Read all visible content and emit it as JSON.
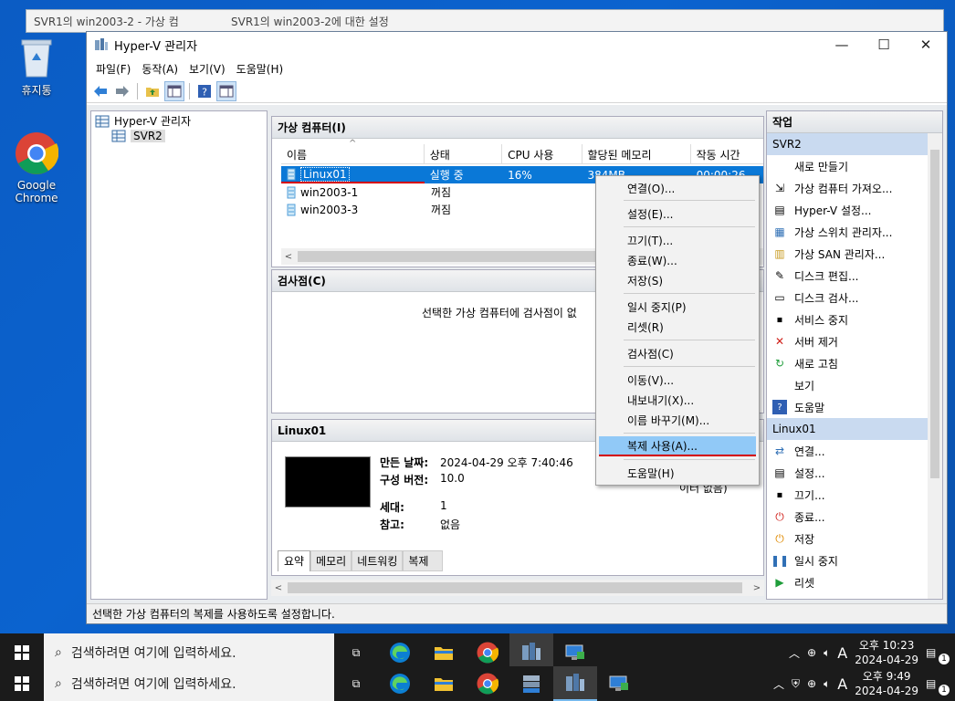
{
  "desktop": {
    "icons": [
      {
        "label": "휴지통"
      },
      {
        "label": "Google Chrome"
      }
    ]
  },
  "background_window": {
    "tab1": "SVR1의 win2003-2 - 가상 컴",
    "tab2": "SVR1의 win2003-2에 대한 설정"
  },
  "window": {
    "title": "Hyper-V 관리자",
    "controls": {
      "minimize": "—",
      "maximize": "☐",
      "close": "✕"
    }
  },
  "menubar": [
    "파일(F)",
    "동작(A)",
    "보기(V)",
    "도움말(H)"
  ],
  "tree": {
    "root": "Hyper-V 관리자",
    "child": "SVR2"
  },
  "vm_panel": {
    "header": "가상 컴퓨터(I)",
    "columns": [
      "이름",
      "상태",
      "CPU 사용",
      "할당된 메모리",
      "작동 시간"
    ],
    "rows": [
      {
        "name": "Linux01",
        "state": "실행 중",
        "cpu": "16%",
        "memory": "384MB",
        "uptime": "00:00:26"
      },
      {
        "name": "win2003-1",
        "state": "꺼짐",
        "cpu": "",
        "memory": "",
        "uptime": ""
      },
      {
        "name": "win2003-3",
        "state": "꺼짐",
        "cpu": "",
        "memory": "",
        "uptime": ""
      }
    ]
  },
  "checkpoint_panel": {
    "header": "검사점(C)",
    "message": "선택한 가상 컴퓨터에 검사점이 없"
  },
  "details_panel": {
    "header": "Linux01",
    "created_label": "만든 날짜:",
    "created_value": "2024-04-29 오후 7:40:46",
    "version_label": "구성 버전:",
    "version_value": "10.0",
    "generation_label": "세대:",
    "generation_value": "1",
    "notes_label": "참고:",
    "notes_value": "없음",
    "side_text": "이터 없음)",
    "tabs": [
      "요약",
      "메모리",
      "네트워킹",
      "복제"
    ]
  },
  "context_menu": {
    "items": [
      "연결(O)...",
      "설정(E)...",
      "끄기(T)...",
      "종료(W)...",
      "저장(S)",
      "일시 중지(P)",
      "리셋(R)",
      "검사점(C)",
      "이동(V)...",
      "내보내기(X)...",
      "이름 바꾸기(M)...",
      "복제 사용(A)...",
      "도움말(H)"
    ]
  },
  "actions": {
    "header": "작업",
    "group1": "SVR2",
    "group1_items": [
      "새로 만들기",
      "가상 컴퓨터 가져오...",
      "Hyper-V 설정...",
      "가상 스위치 관리자...",
      "가상 SAN 관리자...",
      "디스크 편집...",
      "디스크 검사...",
      "서비스 중지",
      "서버 제거",
      "새로 고침",
      "보기",
      "도움말"
    ],
    "group2": "Linux01",
    "group2_items": [
      "연결...",
      "설정...",
      "끄기...",
      "종료...",
      "저장",
      "일시 중지",
      "리셋"
    ]
  },
  "statusbar": "선택한 가상 컴퓨터의 복제를 사용하도록 설정합니다.",
  "taskbar_top": {
    "search": "검색하려면 여기에 입력하세요.",
    "time": "오후 10:23",
    "date": "2024-04-29",
    "lang": "A",
    "badge": "1"
  },
  "taskbar_bottom": {
    "search": "검색하려면 여기에 입력하세요.",
    "time": "오후 9:49",
    "date": "2024-04-29",
    "lang": "A",
    "badge": "1"
  }
}
